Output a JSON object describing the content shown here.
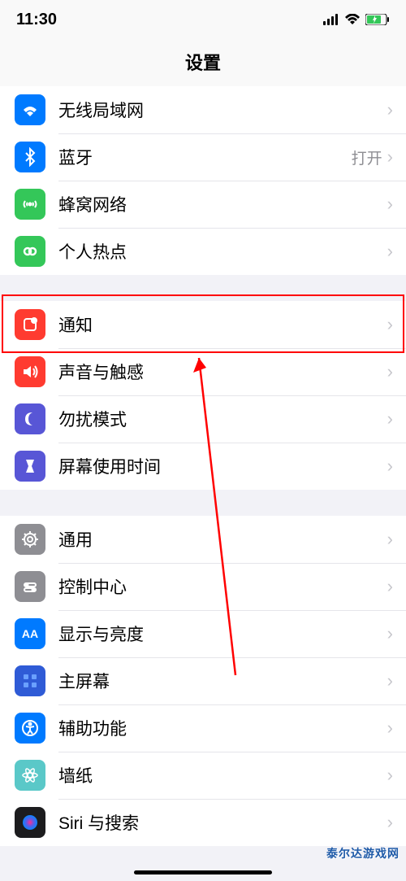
{
  "status": {
    "time": "11:30"
  },
  "header": {
    "title": "设置"
  },
  "groups": [
    {
      "items": [
        {
          "label": "无线局域网",
          "value": "",
          "icon": "wifi",
          "bg": "bg-blue"
        },
        {
          "label": "蓝牙",
          "value": "打开",
          "icon": "bluetooth",
          "bg": "bg-blue"
        },
        {
          "label": "蜂窝网络",
          "value": "",
          "icon": "cellular",
          "bg": "bg-green"
        },
        {
          "label": "个人热点",
          "value": "",
          "icon": "hotspot",
          "bg": "bg-green"
        }
      ]
    },
    {
      "items": [
        {
          "label": "通知",
          "value": "",
          "icon": "notification",
          "bg": "bg-red",
          "highlighted": true
        },
        {
          "label": "声音与触感",
          "value": "",
          "icon": "sound",
          "bg": "bg-red"
        },
        {
          "label": "勿扰模式",
          "value": "",
          "icon": "dnd",
          "bg": "bg-purple"
        },
        {
          "label": "屏幕使用时间",
          "value": "",
          "icon": "screentime",
          "bg": "bg-purple"
        }
      ]
    },
    {
      "items": [
        {
          "label": "通用",
          "value": "",
          "icon": "general",
          "bg": "bg-gray"
        },
        {
          "label": "控制中心",
          "value": "",
          "icon": "control",
          "bg": "bg-gray"
        },
        {
          "label": "显示与亮度",
          "value": "",
          "icon": "display",
          "bg": "bg-blue"
        },
        {
          "label": "主屏幕",
          "value": "",
          "icon": "homescreen",
          "bg": "bg-darkblue"
        },
        {
          "label": "辅助功能",
          "value": "",
          "icon": "accessibility",
          "bg": "bg-blue"
        },
        {
          "label": "墙纸",
          "value": "",
          "icon": "wallpaper",
          "bg": "bg-teal"
        },
        {
          "label": "Siri 与搜索",
          "value": "",
          "icon": "siri",
          "bg": "bg-black"
        }
      ]
    }
  ],
  "watermark": "泰尔达游戏网"
}
